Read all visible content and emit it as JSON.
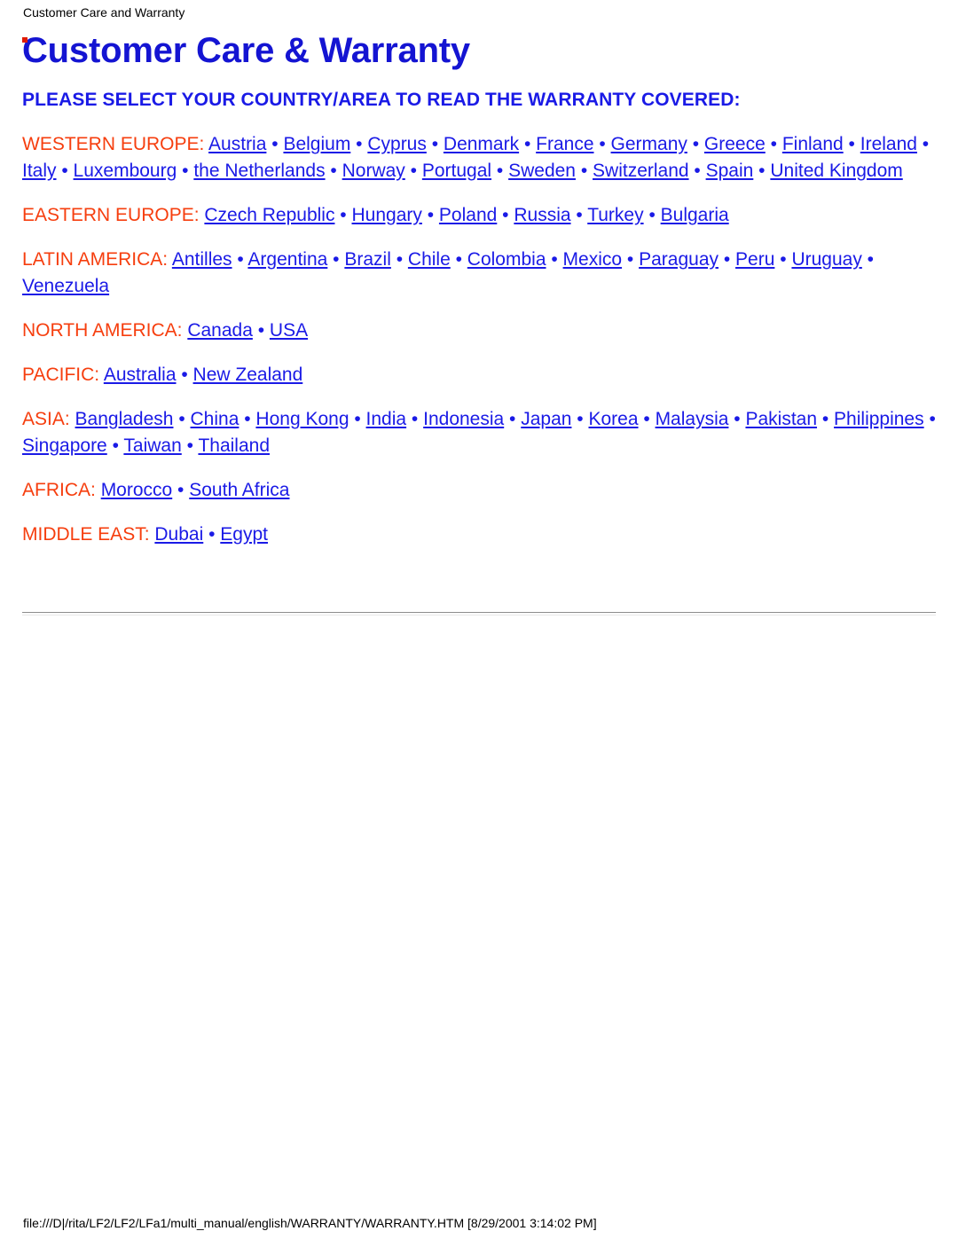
{
  "page_header": "Customer Care and Warranty",
  "title": "Customer Care & Warranty",
  "instruction": "PLEASE SELECT YOUR COUNTRY/AREA TO READ THE WARRANTY COVERED:",
  "separator": " • ",
  "colors": {
    "title_blue": "#1414d2",
    "link_blue": "#1a1ae6",
    "region_orange": "#f63e0e",
    "marker_red": "#e01b00",
    "background": "#ffffff",
    "footer_text": "#000000"
  },
  "regions": [
    {
      "label": "WESTERN EUROPE:",
      "countries": [
        "Austria",
        "Belgium",
        "Cyprus",
        "Denmark",
        "France",
        "Germany",
        "Greece",
        "Finland",
        "Ireland",
        "Italy",
        "Luxembourg",
        "the Netherlands",
        "Norway",
        "Portugal",
        "Sweden",
        "Switzerland",
        "Spain",
        "United Kingdom"
      ]
    },
    {
      "label": "EASTERN EUROPE:",
      "countries": [
        "Czech Republic",
        "Hungary",
        "Poland",
        "Russia",
        "Turkey",
        "Bulgaria"
      ]
    },
    {
      "label": "LATIN AMERICA:",
      "countries": [
        "Antilles",
        "Argentina",
        "Brazil",
        "Chile",
        "Colombia",
        "Mexico",
        "Paraguay",
        "Peru",
        "Uruguay",
        "Venezuela"
      ]
    },
    {
      "label": "NORTH AMERICA:",
      "countries": [
        "Canada",
        "USA"
      ]
    },
    {
      "label": "PACIFIC:",
      "countries": [
        "Australia",
        "New Zealand"
      ]
    },
    {
      "label": "ASIA:",
      "countries": [
        "Bangladesh",
        "China",
        "Hong Kong",
        "India",
        "Indonesia",
        "Japan",
        "Korea",
        "Malaysia",
        "Pakistan",
        "Philippines",
        "Singapore",
        "Taiwan",
        "Thailand"
      ]
    },
    {
      "label": "AFRICA:",
      "countries": [
        "Morocco",
        "South Africa"
      ]
    },
    {
      "label": "MIDDLE EAST:",
      "countries": [
        "Dubai",
        "Egypt"
      ]
    }
  ],
  "page_footer": "file:///D|/rita/LF2/LF2/LFa1/multi_manual/english/WARRANTY/WARRANTY.HTM [8/29/2001 3:14:02 PM]"
}
